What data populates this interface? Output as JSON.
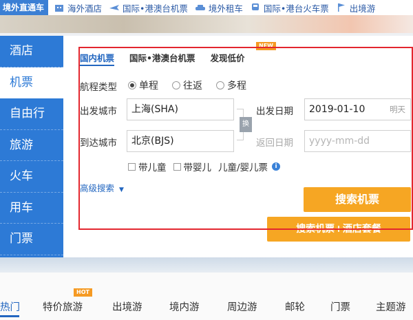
{
  "topnav": {
    "brand": "境外直通车",
    "items": [
      {
        "label": "海外酒店",
        "icon": "hotel-icon"
      },
      {
        "label": "国际•港澳台机票",
        "icon": "plane-icon"
      },
      {
        "label": "境外租车",
        "icon": "car-icon"
      },
      {
        "label": "国际•港台火车票",
        "icon": "train-icon"
      },
      {
        "label": "出境游",
        "icon": "flag-icon"
      }
    ]
  },
  "sidebar": {
    "items": [
      {
        "label": "酒店"
      },
      {
        "label": "机票"
      },
      {
        "label": "自由行"
      },
      {
        "label": "旅游"
      },
      {
        "label": "火车"
      },
      {
        "label": "用车"
      },
      {
        "label": "门票"
      }
    ],
    "active_index": 1
  },
  "flight": {
    "tabs": [
      {
        "label": "国内机票"
      },
      {
        "label": "国际•港澳台机票"
      },
      {
        "label": "发现低价"
      }
    ],
    "new_badge": "NEW",
    "trip_type_label": "航程类型",
    "trip_options": [
      {
        "label": "单程",
        "checked": true
      },
      {
        "label": "往返",
        "checked": false
      },
      {
        "label": "多程",
        "checked": false
      }
    ],
    "depart_city_label": "出发城市",
    "depart_city_value": "上海(SHA)",
    "arrive_city_label": "到达城市",
    "arrive_city_value": "北京(BJS)",
    "swap_label": "换",
    "depart_date_label": "出发日期",
    "depart_date_value": "2019-01-10",
    "depart_date_weekday": "明天",
    "return_date_label": "返回日期",
    "return_date_placeholder": "yyyy-mm-dd",
    "passenger_options": [
      {
        "label": "带儿童"
      },
      {
        "label": "带婴儿"
      }
    ],
    "passenger_note": "儿童/婴儿票",
    "advanced_search": "高级搜索",
    "search_button": "搜索机票",
    "search_combo_button": "搜索机票+酒店套餐"
  },
  "bottom_nav": {
    "items": [
      {
        "label": "热门"
      },
      {
        "label": "特价旅游"
      },
      {
        "label": "出境游"
      },
      {
        "label": "境内游"
      },
      {
        "label": "周边游"
      },
      {
        "label": "邮轮"
      },
      {
        "label": "门票"
      },
      {
        "label": "主题游"
      }
    ],
    "hot_badge": "HOT"
  },
  "colors": {
    "primary_blue": "#2d7ad6",
    "link_blue": "#2266c0",
    "button_orange": "#f6a623",
    "highlight_red": "#e3262e"
  }
}
